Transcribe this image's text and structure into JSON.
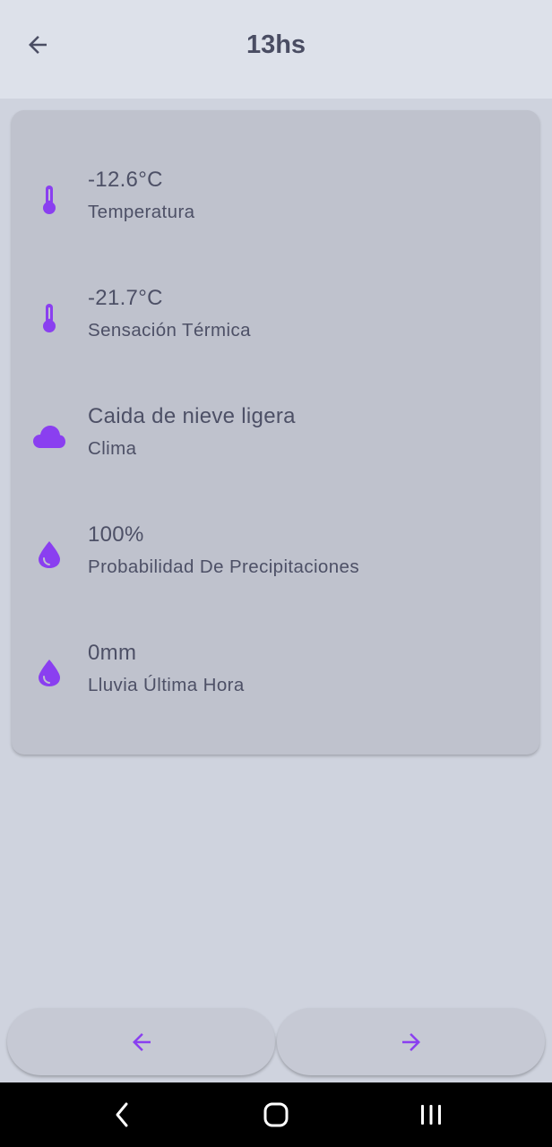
{
  "header": {
    "title": "13hs",
    "back_icon": "arrow-left-icon"
  },
  "details": [
    {
      "value": "-12.6°C",
      "label": "Temperatura",
      "icon": "thermometer-icon"
    },
    {
      "value": "-21.7°C",
      "label": "Sensación Térmica",
      "icon": "thermometer-icon"
    },
    {
      "value": "Caida de nieve ligera",
      "label": "Clima",
      "icon": "cloud-icon"
    },
    {
      "value": "100%",
      "label": "Probabilidad De Precipitaciones",
      "icon": "water-drop-icon"
    },
    {
      "value": "0mm",
      "label": "Lluvia Última Hora",
      "icon": "water-drop-icon"
    }
  ],
  "footer": {
    "prev_icon": "arrow-left-icon",
    "next_icon": "arrow-right-icon"
  },
  "system_nav": {
    "back_icon": "chevron-left-icon",
    "home_icon": "home-icon",
    "recents_icon": "recents-icon"
  },
  "colors": {
    "accent": "#8a3ff0",
    "text": "#4d5066",
    "background": "#cfd3de",
    "app_bar": "#dde1ea",
    "card": "#bfc2cd"
  }
}
